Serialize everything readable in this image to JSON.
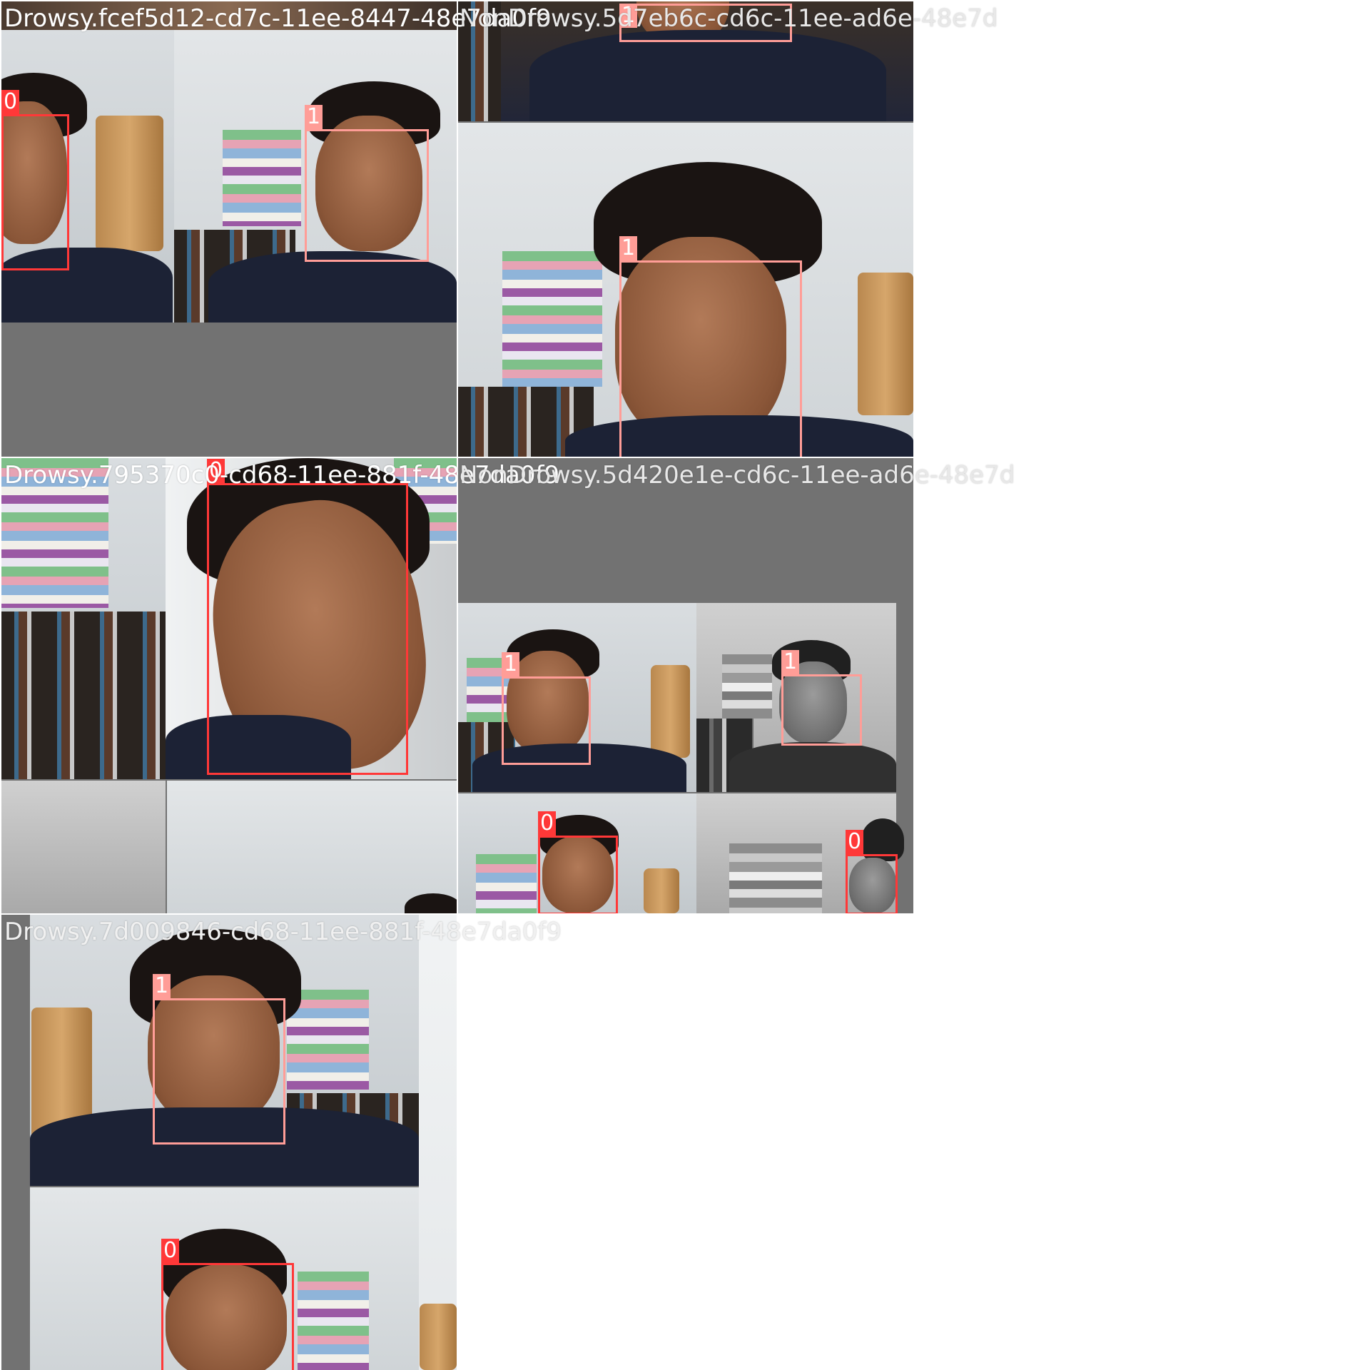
{
  "tiles": [
    {
      "filename": "Drowsy.fcef5d12-cd7c-11ee-8447-48e7da0f9",
      "detections": [
        {
          "class_label": "0"
        },
        {
          "class_label": "1"
        }
      ]
    },
    {
      "filename": "NonDrowsy.5d7eb6c-cd6c-11ee-ad6e-48e7d",
      "detections": [
        {
          "class_label": "1"
        },
        {
          "class_label": "1"
        }
      ]
    },
    {
      "filename": "Drowsy.795370c0-cd68-11ee-881f-48e7da0f9",
      "detections": [
        {
          "class_label": "0"
        }
      ]
    },
    {
      "filename": "NonDrowsy.5d420e1e-cd6c-11ee-ad6e-48e7d",
      "detections": [
        {
          "class_label": "1"
        },
        {
          "class_label": "1"
        },
        {
          "class_label": "0"
        },
        {
          "class_label": "0"
        }
      ]
    },
    {
      "filename": "Drowsy.7d009846-cd68-11ee-881f-48e7da0f9",
      "detections": [
        {
          "class_label": "1"
        },
        {
          "class_label": "0"
        }
      ]
    }
  ],
  "colors": {
    "class_0": "#ff3838",
    "class_1": "#ff9d97",
    "letterbox": "#727272",
    "filename_text": "#ffffff"
  }
}
